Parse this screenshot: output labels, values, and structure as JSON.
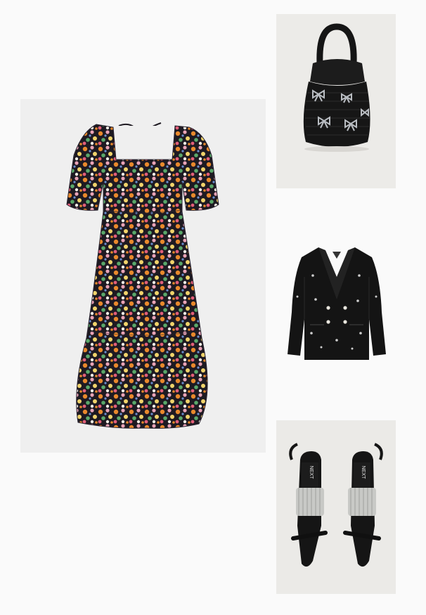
{
  "outfit": {
    "items": [
      {
        "name": "floral-print-midi-dress",
        "icon": "dress-image"
      },
      {
        "name": "black-raffia-bucket-bag",
        "icon": "bag-image"
      },
      {
        "name": "black-embellished-blazer",
        "icon": "jacket-image"
      },
      {
        "name": "black-crystal-strap-sandals",
        "icon": "sandals-image"
      }
    ],
    "colors": {
      "page_background": "#fafafa",
      "tile_background": "#efefef",
      "dress_base": "#1e1a22",
      "accent_orange": "#e8892c",
      "accent_pink": "#e9a3b6",
      "accent_green": "#5aa86a",
      "black_item": "#121212"
    },
    "brand_marks": [
      "NEXT",
      "NEXT"
    ]
  }
}
